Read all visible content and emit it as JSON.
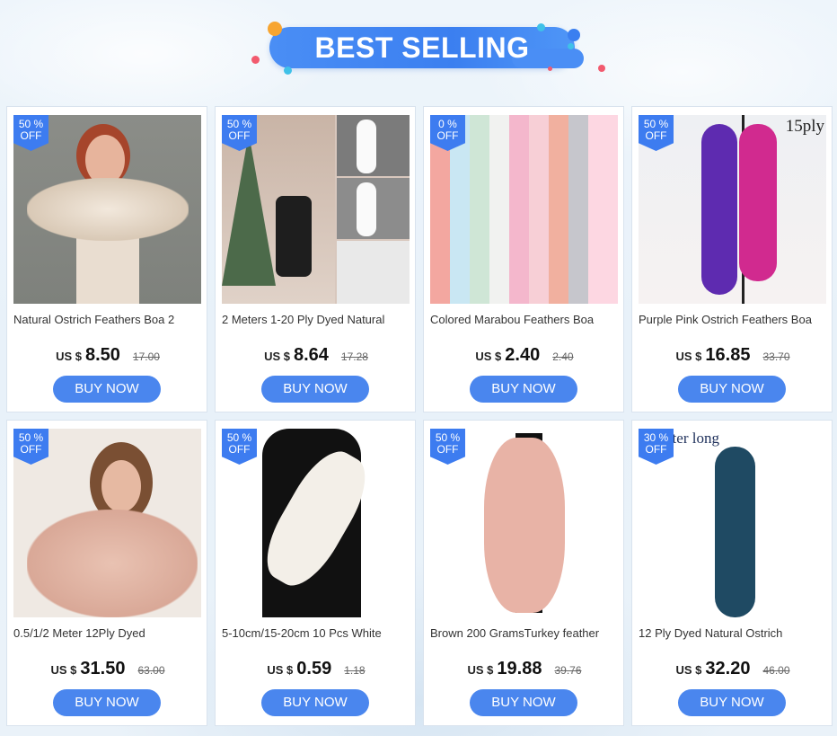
{
  "banner": {
    "title": "BEST SELLING"
  },
  "products": [
    {
      "badge_pct": "50 %",
      "badge_off": "OFF",
      "title": "Natural Ostrich Feathers Boa 2",
      "currency": "US $",
      "price": "8.50",
      "old_price": "17.00",
      "button": "BUY NOW",
      "overlay": ""
    },
    {
      "badge_pct": "50 %",
      "badge_off": "OFF",
      "title": "2 Meters 1-20 Ply Dyed Natural",
      "currency": "US $",
      "price": "8.64",
      "old_price": "17.28",
      "button": "BUY NOW",
      "overlay": ""
    },
    {
      "badge_pct": "0 %",
      "badge_off": "OFF",
      "title": "Colored Marabou Feathers Boa",
      "currency": "US $",
      "price": "2.40",
      "old_price": "2.40",
      "button": "BUY NOW",
      "overlay": ""
    },
    {
      "badge_pct": "50 %",
      "badge_off": "OFF",
      "title": "Purple Pink Ostrich Feathers Boa",
      "currency": "US $",
      "price": "16.85",
      "old_price": "33.70",
      "button": "BUY NOW",
      "overlay": "15ply"
    },
    {
      "badge_pct": "50 %",
      "badge_off": "OFF",
      "title": "0.5/1/2 Meter 12Ply Dyed",
      "currency": "US $",
      "price": "31.50",
      "old_price": "63.00",
      "button": "BUY NOW",
      "overlay": ""
    },
    {
      "badge_pct": "50 %",
      "badge_off": "OFF",
      "title": "5-10cm/15-20cm 10 Pcs White",
      "currency": "US $",
      "price": "0.59",
      "old_price": "1.18",
      "button": "BUY NOW",
      "overlay": ""
    },
    {
      "badge_pct": "50 %",
      "badge_off": "OFF",
      "title": "Brown 200 GramsTurkey feather",
      "currency": "US $",
      "price": "19.88",
      "old_price": "39.76",
      "button": "BUY NOW",
      "overlay": ""
    },
    {
      "badge_pct": "30 %",
      "badge_off": "OFF",
      "title": "12 Ply Dyed Natural Ostrich",
      "currency": "US $",
      "price": "32.20",
      "old_price": "46.00",
      "button": "BUY NOW",
      "overlay": "eter long"
    }
  ],
  "colors": {
    "accent": "#4a86ee",
    "badge": "#3d7cf0"
  }
}
